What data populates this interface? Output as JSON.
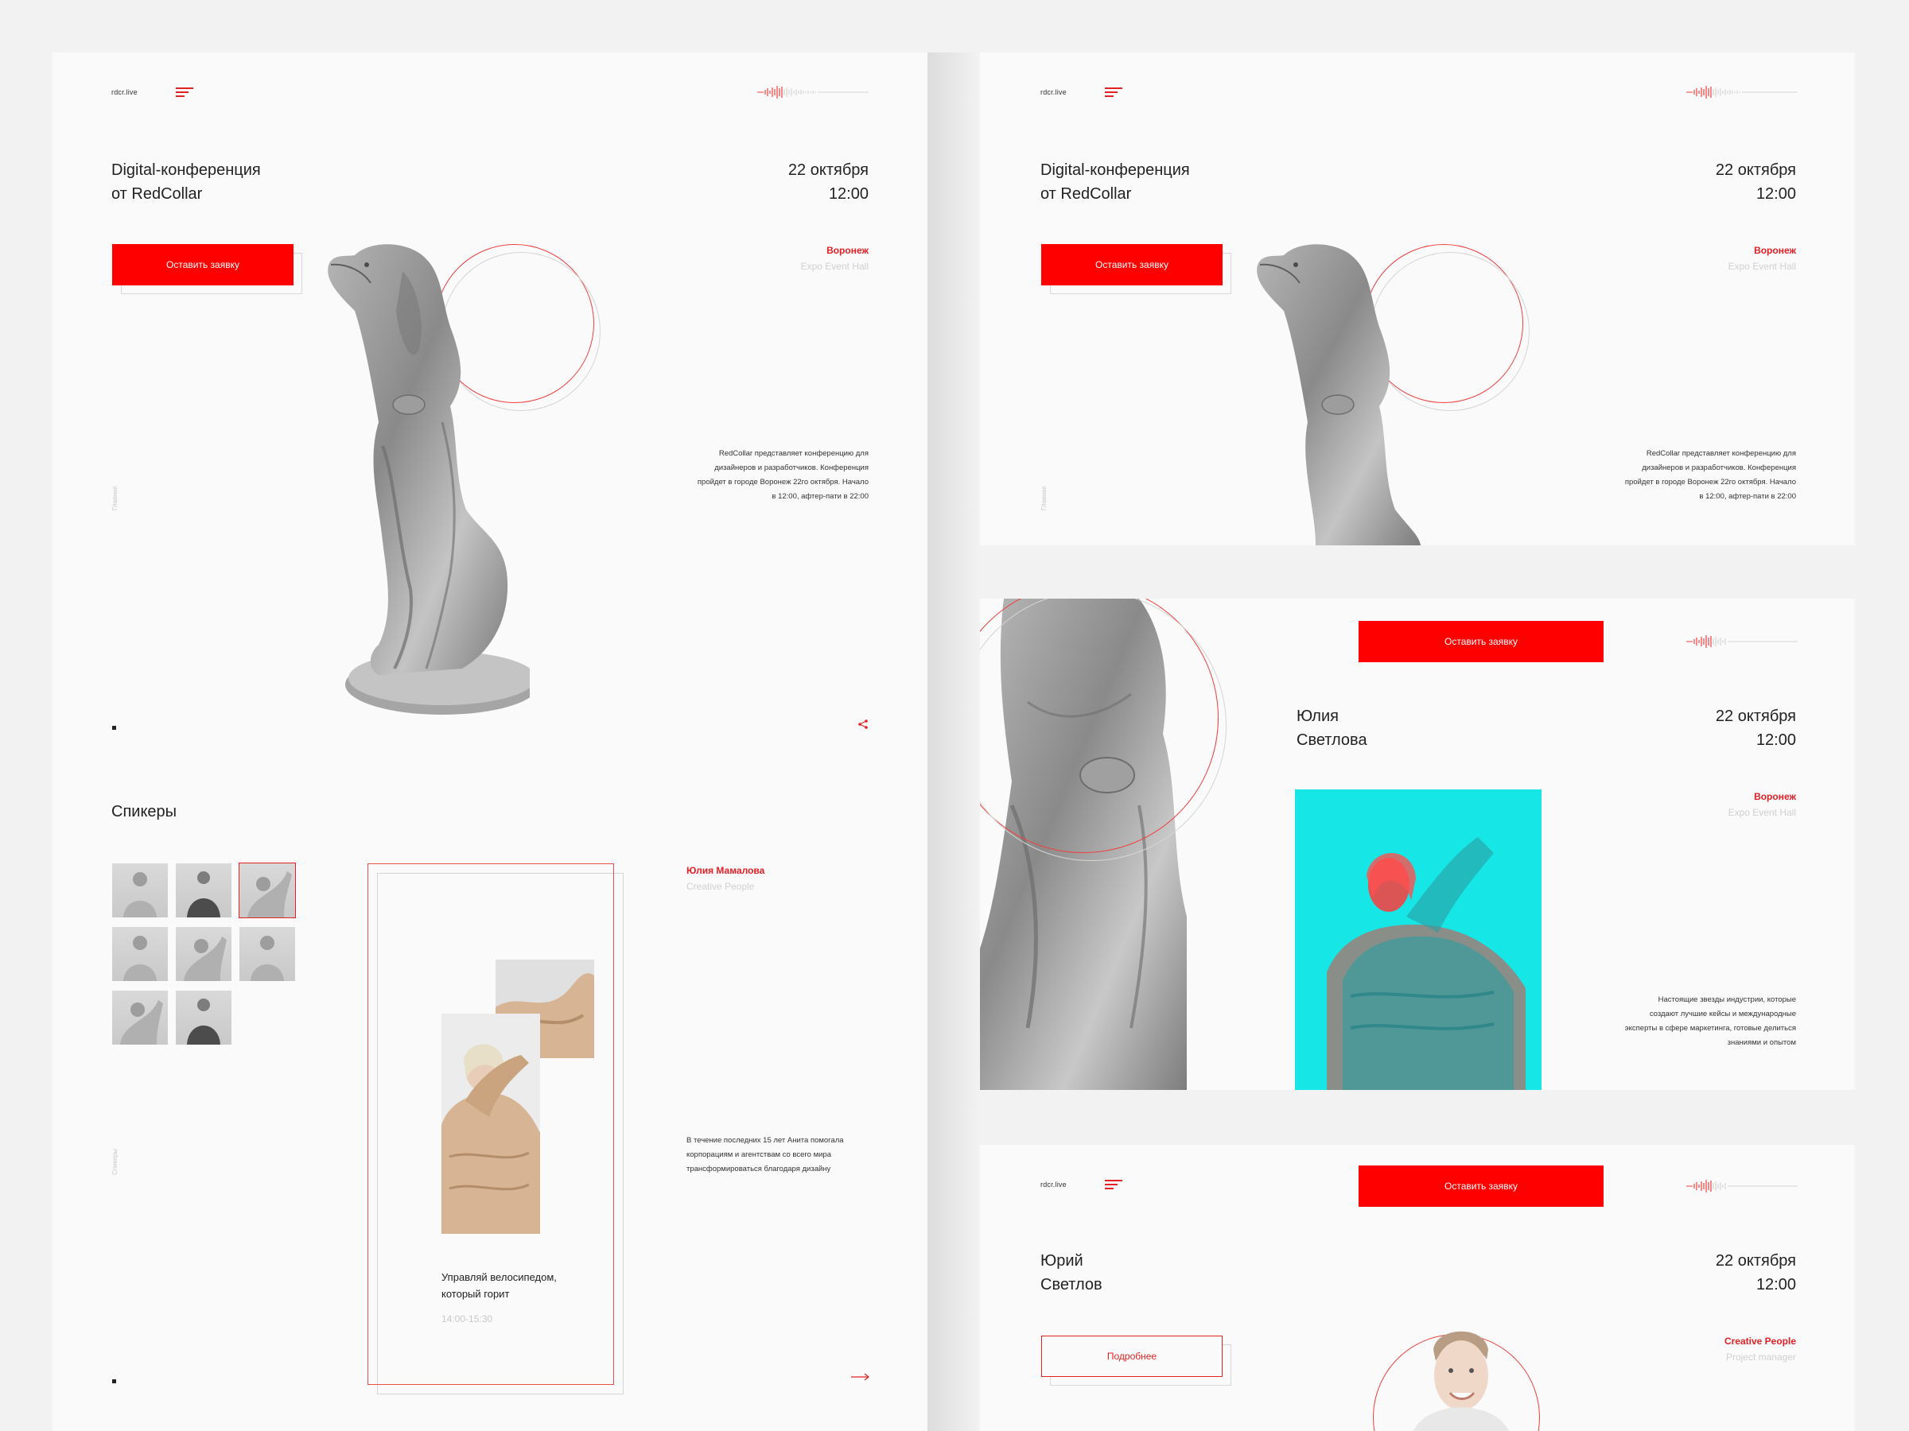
{
  "brand": {
    "logo": "rdcr.live",
    "accent": "#ff0000",
    "secondary_accent": "#17e6e6"
  },
  "screen1": {
    "title": [
      "Digital-конференция",
      "от RedCollar"
    ],
    "date": [
      "22 октября",
      "12:00"
    ],
    "cta_label": "Оставить заявку",
    "city": "Воронеж",
    "venue": "Expo Event Hall",
    "description": [
      "RedCollar представляет конференцию для",
      "дизайнеров и разработчиков. Конференция",
      "пройдет в городе Воронеж 22го октября. Начало",
      "в 12:00, афтер-пати в 22:00"
    ],
    "side_label": "Главная"
  },
  "screen2": {
    "section_title": "Спикеры",
    "speaker_name": "Юлия Мамалова",
    "speaker_company": "Creative People",
    "talk_title": [
      "Управляй велосипедом,",
      "который горит"
    ],
    "talk_time": "14:00-15:30",
    "bio": [
      "В течение последних 15 лет Анита помогала",
      "корпорациям и агентствам со всего мира",
      "трансформироваться благодаря дизайну"
    ],
    "side_label": "Спикеры"
  },
  "screen3": {
    "title": [
      "Digital-конференция",
      "от RedCollar"
    ],
    "date": [
      "22 октября",
      "12:00"
    ],
    "cta_label": "Оставить заявку",
    "city": "Воронеж",
    "venue": "Expo Event Hall",
    "description": [
      "RedCollar представляет конференцию для",
      "дизайнеров и разработчиков. Конференция",
      "пройдет в городе Воронеж 22го октября. Начало",
      "в 12:00, афтер-пати в 22:00"
    ],
    "side_label": "Главная"
  },
  "screen4": {
    "cta_label": "Оставить заявку",
    "name": [
      "Юлия",
      "Светлова"
    ],
    "date": [
      "22 октября",
      "12:00"
    ],
    "city": "Воронеж",
    "venue": "Expo Event Hall",
    "description": [
      "Настоящие звезды индустрии, которые",
      "создают лучшие кейсы и международные",
      "эксперты в сфере маркетинга, готовые делиться",
      "знаниями и опытом"
    ]
  },
  "screen5": {
    "cta_label": "Оставить заявку",
    "name": [
      "Юрий",
      "Светлов"
    ],
    "date": [
      "22 октября",
      "12:00"
    ],
    "more_label": "Подробнее",
    "company": "Creative People",
    "role": "Project manager"
  },
  "icons": [
    "menu-icon",
    "soundwave-icon",
    "share-icon",
    "arrow-right-icon"
  ]
}
